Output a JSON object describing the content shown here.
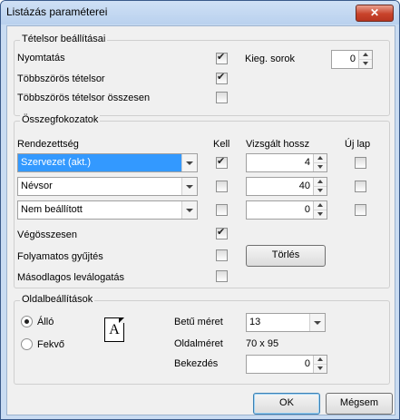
{
  "window": {
    "title": "Listázás paraméterei",
    "close_glyph": "✕"
  },
  "tetelsor": {
    "title": "Tételsor beállításai",
    "nyomtatas_label": "Nyomtatás",
    "nyomtatas_checked": true,
    "tobbszoros_label": "Többszörös tételsor",
    "tobbszoros_checked": true,
    "osszesen_label": "Többszörös tételsor összesen",
    "osszesen_checked": false,
    "kieg_label": "Kieg. sorok",
    "kieg_value": "0"
  },
  "osszeg": {
    "title": "Összegfokozatok",
    "col_rendezettseg": "Rendezettség",
    "col_kell": "Kell",
    "col_vizsgalt": "Vizsgált hossz",
    "col_ujlap": "Új lap",
    "rows": [
      {
        "value": "Szervezet (akt.)",
        "kell": true,
        "hossz": "4",
        "ujlap": false
      },
      {
        "value": "Névsor",
        "kell": false,
        "hossz": "40",
        "ujlap": false
      },
      {
        "value": "Nem beállított",
        "kell": false,
        "hossz": "0",
        "ujlap": false
      }
    ],
    "vegosszesen_label": "Végösszesen",
    "vegosszesen_checked": true,
    "folyamatos_label": "Folyamatos gyűjtés",
    "folyamatos_checked": false,
    "masodlagos_label": "Másodlagos leválogatás",
    "masodlagos_checked": false,
    "torles_label": "Törlés"
  },
  "oldal": {
    "title": "Oldalbeállítások",
    "allo_label": "Álló",
    "fekvo_label": "Fekvő",
    "orientation": "allo",
    "page_letter": "A",
    "betumeret_label": "Betű méret",
    "betumeret_value": "13",
    "oldalmeret_label": "Oldalméret",
    "oldalmeret_value": "70 x 95",
    "bekezdes_label": "Bekezdés",
    "bekezdes_value": "0"
  },
  "buttons": {
    "ok_label": "OK",
    "cancel_label": "Mégsem"
  }
}
